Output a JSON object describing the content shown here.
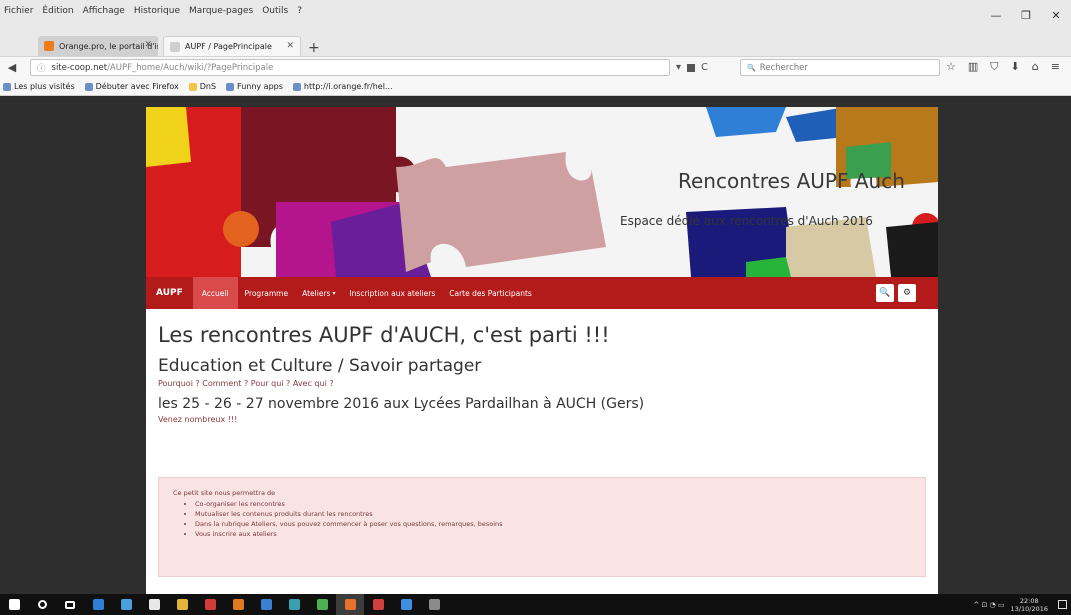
{
  "menubar": {
    "items": [
      "Fichier",
      "Édition",
      "Affichage",
      "Historique",
      "Marque-pages",
      "Outils",
      "?"
    ]
  },
  "window_controls": {
    "minimize": "—",
    "maximize": "❐",
    "close": "✕"
  },
  "tabs": [
    {
      "label": "Orange.pro, le portail d'inf...",
      "favicon_color": "#f07d1a",
      "close": "✕"
    },
    {
      "label": "AUPF / PagePrincipale",
      "favicon_color": "#cfcfcf",
      "close": "✕"
    }
  ],
  "new_tab_label": "+",
  "navigation": {
    "back": "◀",
    "info": "ⓘ",
    "url_host": "site-coop.net",
    "url_path": "/AUPF_home/Auch/wiki/?PagePrincipale",
    "reload": "C",
    "dropdown": "▾",
    "search_placeholder": "Rechercher",
    "search_icon": "🔍",
    "icons": [
      "star-icon",
      "library-icon",
      "pocket-icon",
      "download-icon",
      "home-icon",
      "menu-icon"
    ],
    "icon_glyphs": [
      "☆",
      "▥",
      "⛉",
      "⬇",
      "⌂",
      "≡"
    ]
  },
  "bookmarks": [
    {
      "label": "Les plus visités",
      "folder": false
    },
    {
      "label": "Débuter avec Firefox",
      "folder": false
    },
    {
      "label": "DnS",
      "folder": true
    },
    {
      "label": "Funny apps",
      "folder": false
    },
    {
      "label": "http://i.orange.fr/hel...",
      "folder": false
    }
  ],
  "site": {
    "title": "Rencontres AUPF Auch",
    "description": "Espace dédié aux rencontres d'Auch 2016",
    "nav": {
      "brand": "AUPF",
      "links": [
        "Accueil",
        "Programme",
        "Ateliers",
        "Inscription aux ateliers",
        "Carte des Participants"
      ],
      "active_index": 0,
      "dropdown_caret": "▾",
      "search_glyph": "🔍",
      "settings_glyph": "⚙"
    },
    "h1": "Les rencontres AUPF d'AUCH, c'est parti !!!",
    "h2": "Education et Culture / Savoir partager",
    "subtitle": "Pourquoi ? Comment ? Pour qui ? Avec qui ?",
    "h3": "les 25 - 26 - 27 novembre 2016 aux Lycées Pardailhan à AUCH (Gers)",
    "cta": "Venez nombreux !!!",
    "alert": {
      "intro": "Ce petit site nous permettra de",
      "items": [
        "Co-organiser les rencontres",
        "Mutualiser les contenus produits durant les rencontres",
        "Dans la rubrique Ateliers, vous pouvez commencer à poser vos questions, remarques, besoins",
        "Vous inscrire aux ateliers"
      ]
    }
  },
  "taskbar": {
    "apps": [
      {
        "name": "start-icon",
        "color": "#ffffff"
      },
      {
        "name": "search-icon",
        "color": "#ffffff"
      },
      {
        "name": "task-view-icon",
        "color": "#ffffff"
      },
      {
        "name": "edge-icon",
        "color": "#2f7fd6"
      },
      {
        "name": "files-icon",
        "color": "#4a9fe0"
      },
      {
        "name": "store-icon",
        "color": "#e8e8e8"
      },
      {
        "name": "chrome-icon",
        "color": "#e2b43a"
      },
      {
        "name": "app-red-icon",
        "color": "#d33a3a"
      },
      {
        "name": "app-orange-icon",
        "color": "#e07a20"
      },
      {
        "name": "app-blue-icon",
        "color": "#3a7fd0"
      },
      {
        "name": "app-teal-icon",
        "color": "#3aa0b0"
      },
      {
        "name": "app-green-icon",
        "color": "#4caf50"
      },
      {
        "name": "firefox-icon",
        "color": "#e8722a"
      },
      {
        "name": "app-purple-icon",
        "color": "#d04040"
      },
      {
        "name": "app-lightblue-icon",
        "color": "#3f8fe0"
      },
      {
        "name": "app-gray-icon",
        "color": "#8a8a8a"
      }
    ],
    "active_index": 12,
    "tray_glyphs": "^ ⊡ ◔ ▭",
    "time": "22:08",
    "date": "13/10/2016"
  }
}
